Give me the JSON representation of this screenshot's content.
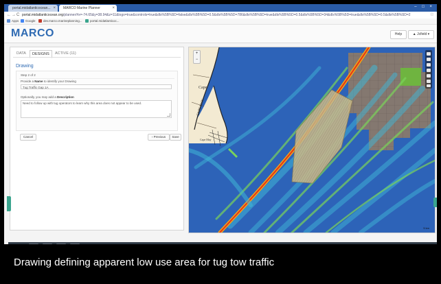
{
  "browser": {
    "tabs": [
      {
        "label": "portal.midatlanticocean..."
      },
      {
        "label": "MARCO Marine Planner"
      }
    ],
    "url_host": "portal.midatlanticocean.org",
    "url_rest": "/planner/#x=-74.65&y=38.94&z=11&logo=true&controls=true&dls%5B%5D=false&dls%5B%5D=0.5&dls%5B%5D=786&dls%5B%5D=true&dls%5B%5D=0.5&dls%5B%5D=34&dls%5B%5D=true&dls%5B%5D=0.5&dls%5B%5D=2",
    "bookmarks": [
      {
        "label": "Apps",
        "color": "#5b8dd6"
      },
      {
        "label": "Google",
        "color": "#4285f4"
      },
      {
        "label": "dev.marco.marineplanning...",
        "color": "#c23b2a"
      },
      {
        "label": "portal.midatlanticoc...",
        "color": "#3aa58e"
      }
    ]
  },
  "app": {
    "logo": "MARCO",
    "help_label": "Help",
    "user_label": "▲ Jcfield ▾"
  },
  "panel": {
    "tabs": [
      {
        "label": "DATA",
        "active": false
      },
      {
        "label": "DESIGNS",
        "active": true
      },
      {
        "label": "ACTIVE (11)",
        "active": false
      }
    ],
    "title": "Drawing",
    "step": "Step 2 of 2",
    "name_prompt_pre": "Provide a",
    "name_prompt_bold": "Name",
    "name_prompt_post": "to identify your Drawing",
    "name_value": "Tug Traffic Gap 1A",
    "desc_prompt_pre": "Optionally, you may add a",
    "desc_prompt_bold": "Description",
    "desc_value": "Need to follow up with tug operators to learn why this area does not appear to be used.",
    "cancel_label": "Cancel",
    "previous_label": "‹ Previous",
    "save_label": "Save"
  },
  "map": {
    "zoom_in": "+",
    "zoom_out": "−",
    "place_labels": [
      "Cape",
      "CAPE MAY",
      "Cape May"
    ],
    "scale": "5 km",
    "colors": {
      "water": "#2d63b8",
      "traffic_low": "#3fb6d6",
      "traffic_mid": "#7ad35a",
      "traffic_high": "#f2a516",
      "traffic_peak": "#e2331c",
      "drawing_fill": "#c9b98a",
      "wind_grid": "#8c7a6a",
      "land": "#f3ead2"
    }
  },
  "caption": "Drawing defining apparent low use area for tug tow traffic"
}
